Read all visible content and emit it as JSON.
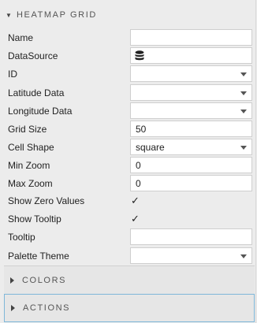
{
  "section": {
    "title": "HEATMAP GRID"
  },
  "fields": {
    "name": {
      "label": "Name",
      "value": ""
    },
    "datasource": {
      "label": "DataSource",
      "icon": "database-icon"
    },
    "id": {
      "label": "ID",
      "value": ""
    },
    "latitude": {
      "label": "Latitude Data",
      "value": ""
    },
    "longitude": {
      "label": "Longitude Data",
      "value": ""
    },
    "grid_size": {
      "label": "Grid Size",
      "value": "50"
    },
    "cell_shape": {
      "label": "Cell Shape",
      "value": "square"
    },
    "min_zoom": {
      "label": "Min Zoom",
      "value": "0"
    },
    "max_zoom": {
      "label": "Max Zoom",
      "value": "0"
    },
    "show_zero": {
      "label": "Show Zero Values",
      "checked": "✓"
    },
    "show_tooltip": {
      "label": "Show Tooltip",
      "checked": "✓"
    },
    "tooltip": {
      "label": "Tooltip",
      "value": ""
    },
    "palette": {
      "label": "Palette Theme",
      "value": ""
    }
  },
  "collapsed_sections": {
    "colors": "COLORS",
    "actions": "ACTIONS"
  }
}
